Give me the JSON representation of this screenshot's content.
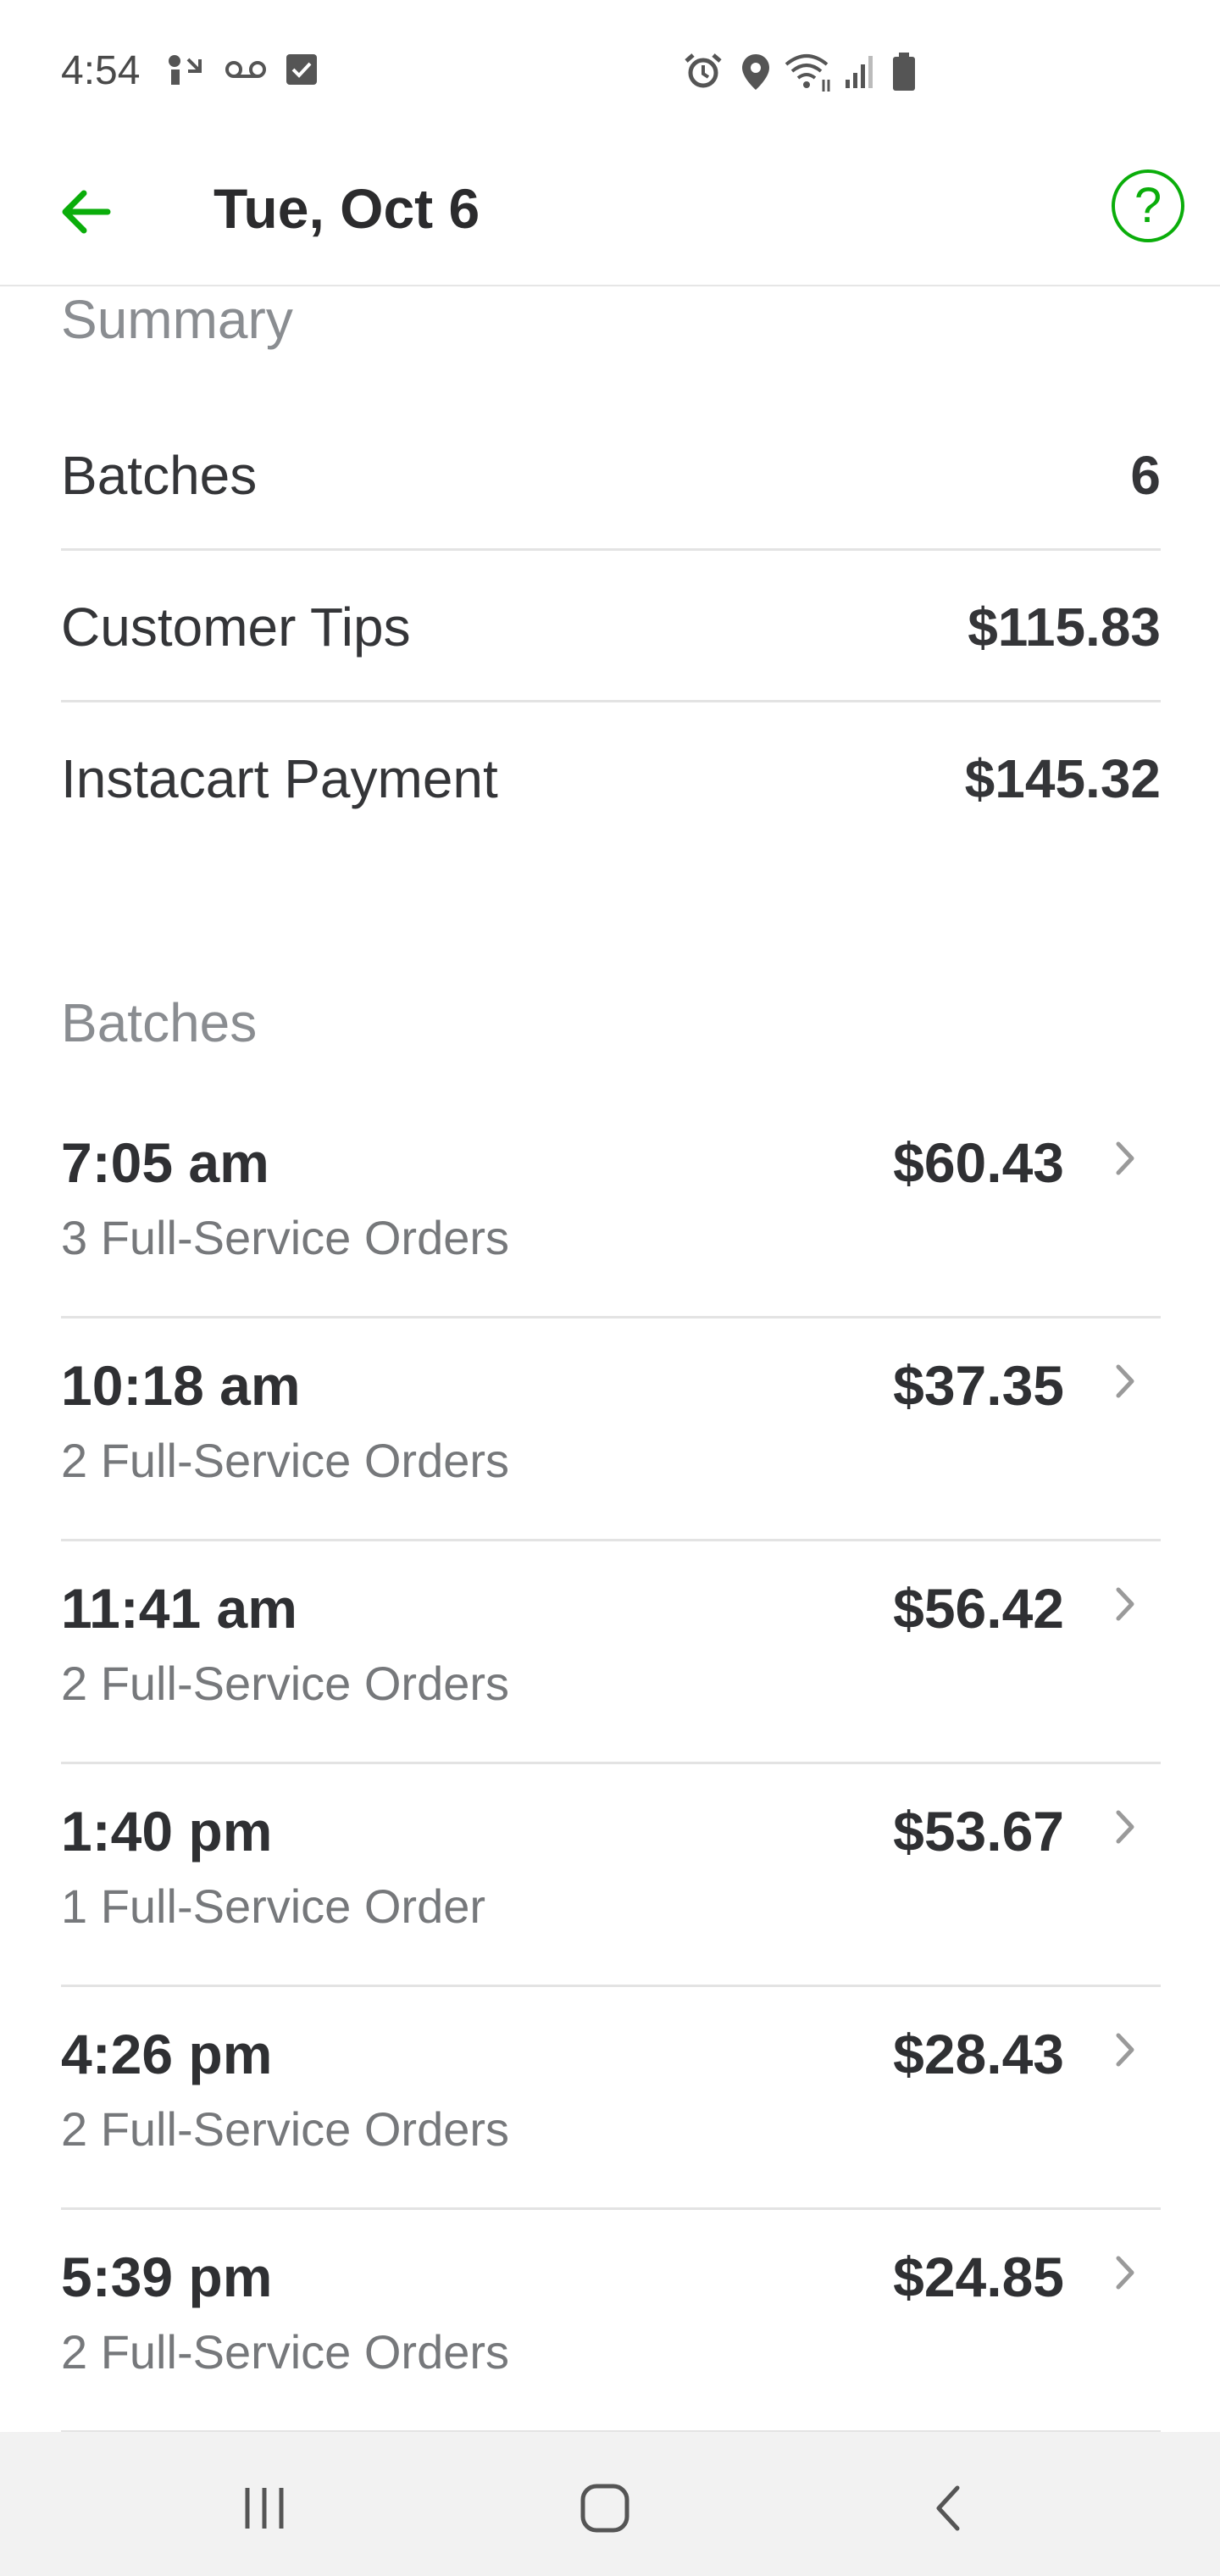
{
  "status_bar": {
    "time": "4:54"
  },
  "header": {
    "title": "Tue, Oct 6",
    "back_icon": "arrow-left-icon",
    "help_label": "?",
    "accent_color": "#0aad0a"
  },
  "summary": {
    "heading": "Summary",
    "rows": [
      {
        "label": "Batches",
        "value": "6"
      },
      {
        "label": "Customer Tips",
        "value": "$115.83"
      },
      {
        "label": "Instacart Payment",
        "value": "$145.32"
      }
    ]
  },
  "batches": {
    "heading": "Batches",
    "items": [
      {
        "time": "7:05 am",
        "orders": "3 Full-Service Orders",
        "amount": "$60.43"
      },
      {
        "time": "10:18 am",
        "orders": "2 Full-Service Orders",
        "amount": "$37.35"
      },
      {
        "time": "11:41 am",
        "orders": "2 Full-Service Orders",
        "amount": "$56.42"
      },
      {
        "time": "1:40 pm",
        "orders": "1 Full-Service Order",
        "amount": "$53.67"
      },
      {
        "time": "4:26 pm",
        "orders": "2 Full-Service Orders",
        "amount": "$28.43"
      },
      {
        "time": "5:39 pm",
        "orders": "2 Full-Service Orders",
        "amount": "$24.85"
      }
    ]
  }
}
